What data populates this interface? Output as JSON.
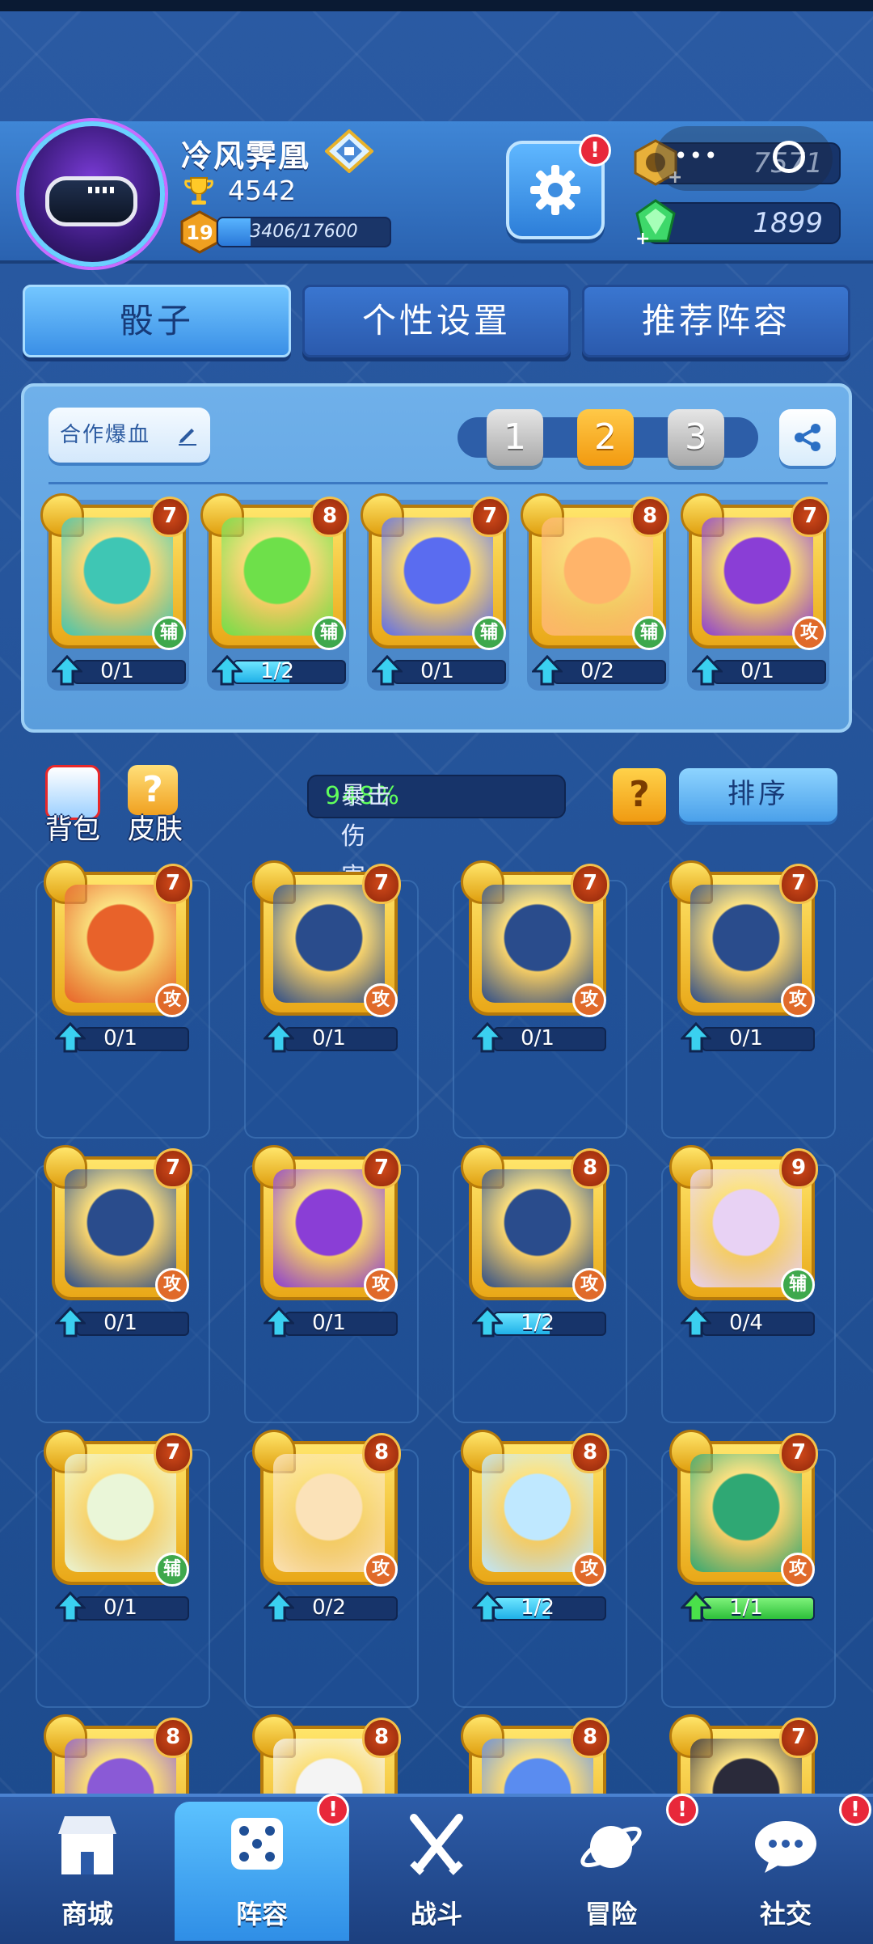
{
  "player": {
    "name": "冷风霁凰",
    "trophies": "4542",
    "level": "19",
    "xp_text": "3406/17600",
    "xp_progress": 0.19
  },
  "currency": {
    "gold": "757",
    "gold_partial_hint": "1",
    "gems": "1899"
  },
  "alerts": {
    "settings": "!",
    "lineup": "!",
    "adventure": "!",
    "social": "!"
  },
  "tabs": [
    {
      "label": "骰子",
      "active": true
    },
    {
      "label": "个性设置",
      "active": false
    },
    {
      "label": "推荐阵容",
      "active": false
    }
  ],
  "deck": {
    "name": "合作爆血",
    "slots": [
      "1",
      "2",
      "3"
    ],
    "active_slot": 1,
    "cards": [
      {
        "icon": "teal-swirl-dice",
        "level": "7",
        "type": "辅",
        "progress": "0/1",
        "fill": 0,
        "color": "#3fc6b4"
      },
      {
        "icon": "green-cross-dice",
        "level": "8",
        "type": "辅",
        "progress": "1/2",
        "fill": 0.5,
        "color": "#6ee04a"
      },
      {
        "icon": "blue-knight-dice",
        "level": "7",
        "type": "辅",
        "progress": "0/1",
        "fill": 0,
        "color": "#5a6cf0"
      },
      {
        "icon": "lucky-cat-dice",
        "level": "8",
        "type": "辅",
        "progress": "0/2",
        "fill": 0,
        "color": "#ffb46a"
      },
      {
        "icon": "purple-demon-dice",
        "level": "7",
        "type": "攻",
        "progress": "0/1",
        "fill": 0,
        "color": "#8a3ed6"
      }
    ]
  },
  "tools": {
    "bag": "背包",
    "skin": "皮肤"
  },
  "crit": {
    "label": "暴击伤害:",
    "value": "948%"
  },
  "help": "?",
  "sort": "排序",
  "collection": [
    {
      "icon": "archer-flame-dice",
      "level": "7",
      "type": "攻",
      "progress": "0/1",
      "fill": 0,
      "color": "#e8622a"
    },
    {
      "icon": "twins-dice",
      "level": "7",
      "type": "攻",
      "progress": "0/1",
      "fill": 0,
      "color": "#2a4c8c"
    },
    {
      "icon": "ox-dice",
      "level": "7",
      "type": "攻",
      "progress": "0/1",
      "fill": 0,
      "color": "#2a4c8c"
    },
    {
      "icon": "ghost-dice",
      "level": "7",
      "type": "攻",
      "progress": "0/1",
      "fill": 0,
      "color": "#2a4c8c"
    },
    {
      "icon": "aquarius-dice",
      "level": "7",
      "type": "攻",
      "progress": "0/1",
      "fill": 0,
      "color": "#2a4c8c"
    },
    {
      "icon": "purple-demon-dice",
      "level": "7",
      "type": "攻",
      "progress": "0/1",
      "fill": 0,
      "color": "#8a3ed6"
    },
    {
      "icon": "bow-dice",
      "level": "8",
      "type": "攻",
      "progress": "1/2",
      "fill": 0.5,
      "color": "#2a4c8c"
    },
    {
      "icon": "witch-hat-dice",
      "level": "9",
      "type": "辅",
      "progress": "0/4",
      "fill": 0,
      "color": "#e8d2f4"
    },
    {
      "icon": "dandelion-dice",
      "level": "7",
      "type": "辅",
      "progress": "0/1",
      "fill": 0,
      "color": "#eaf6d8"
    },
    {
      "icon": "holy-cross-dice",
      "level": "8",
      "type": "攻",
      "progress": "0/2",
      "fill": 0,
      "color": "#fbe2b8"
    },
    {
      "icon": "lightning-dice",
      "level": "8",
      "type": "攻",
      "progress": "1/2",
      "fill": 0.5,
      "color": "#bfe8ff"
    },
    {
      "icon": "slime-dice",
      "level": "7",
      "type": "攻",
      "progress": "1/1",
      "fill": 1,
      "color": "#2fa874"
    },
    {
      "icon": "purple-blob-dice",
      "level": "8",
      "type": "",
      "progress": "",
      "fill": 0,
      "color": "#8a5ad6"
    },
    {
      "icon": "panda-dice",
      "level": "8",
      "type": "",
      "progress": "",
      "fill": 0,
      "color": "#f4f4f4"
    },
    {
      "icon": "blue-cloud-dice",
      "level": "8",
      "type": "",
      "progress": "",
      "fill": 0,
      "color": "#5a8cf0"
    },
    {
      "icon": "black-dice",
      "level": "7",
      "type": "",
      "progress": "",
      "fill": 0,
      "color": "#2a2a3a"
    }
  ],
  "nav": [
    {
      "label": "商城",
      "icon": "shop-icon"
    },
    {
      "label": "阵容",
      "icon": "dice-icon",
      "active": true
    },
    {
      "label": "战斗",
      "icon": "swords-icon"
    },
    {
      "label": "冒险",
      "icon": "planet-icon"
    },
    {
      "label": "社交",
      "icon": "chat-icon"
    }
  ]
}
